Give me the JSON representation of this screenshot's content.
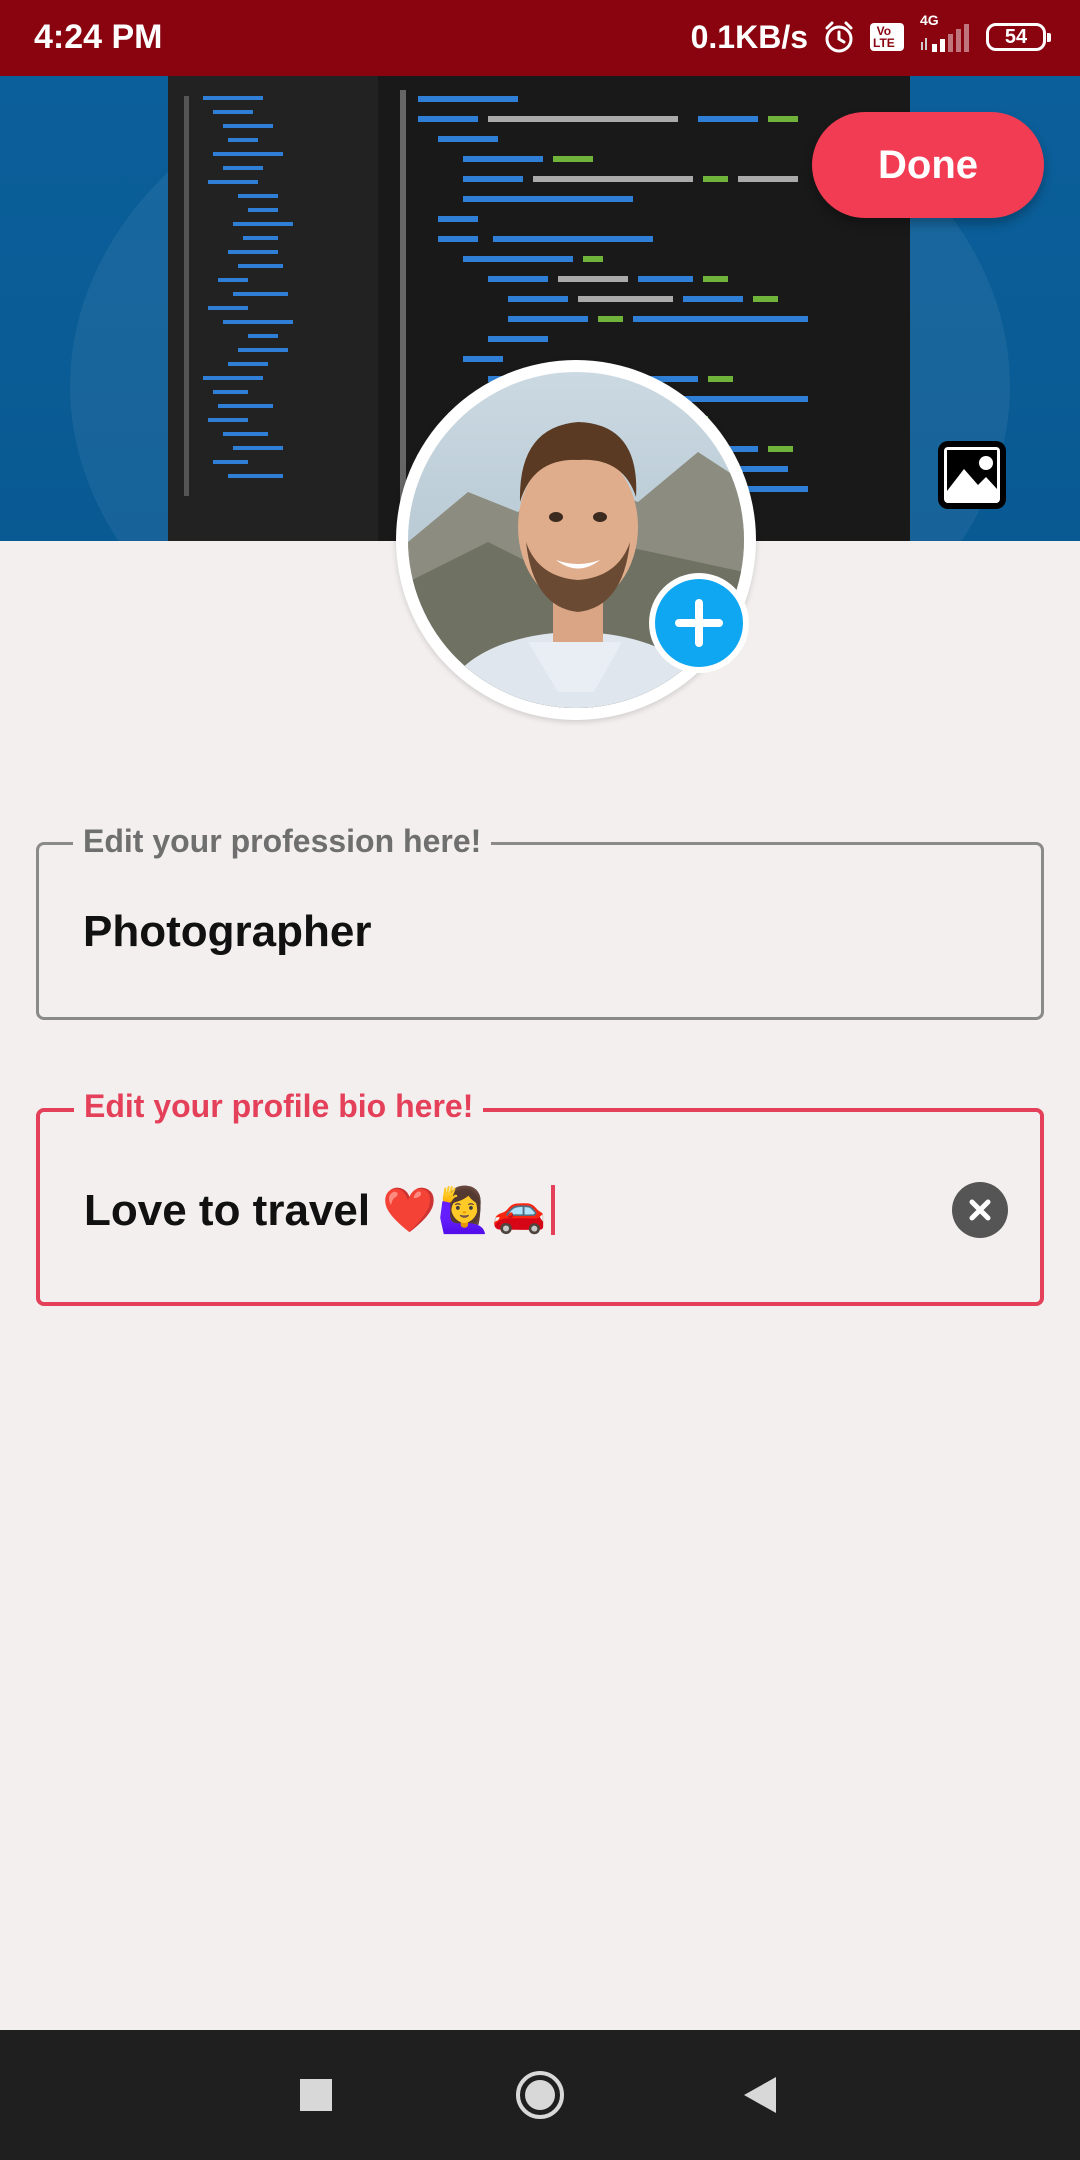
{
  "status_bar": {
    "time": "4:24 PM",
    "network_speed": "0.1KB/s",
    "volte_label": "Vo\nLTE",
    "network_type": "4G",
    "battery_level": "54",
    "icons": [
      "alarm-icon",
      "volte-icon",
      "signal-icon",
      "battery-icon"
    ]
  },
  "header": {
    "done_label": "Done",
    "done_color": "#f23c53",
    "cover_icon": "image-icon",
    "add_photo_icon": "plus-icon",
    "add_photo_color": "#10a7f2"
  },
  "profession_field": {
    "label": "Edit your profession here!",
    "value": "Photographer"
  },
  "bio_field": {
    "label": "Edit your profile bio here!",
    "value": "Love to travel ❤️🙋‍♀️🚗",
    "accent_color": "#e5405a",
    "clear_icon": "clear-icon"
  },
  "nav_bar": {
    "icons": [
      "recents-square-icon",
      "home-circle-icon",
      "back-triangle-icon"
    ]
  }
}
